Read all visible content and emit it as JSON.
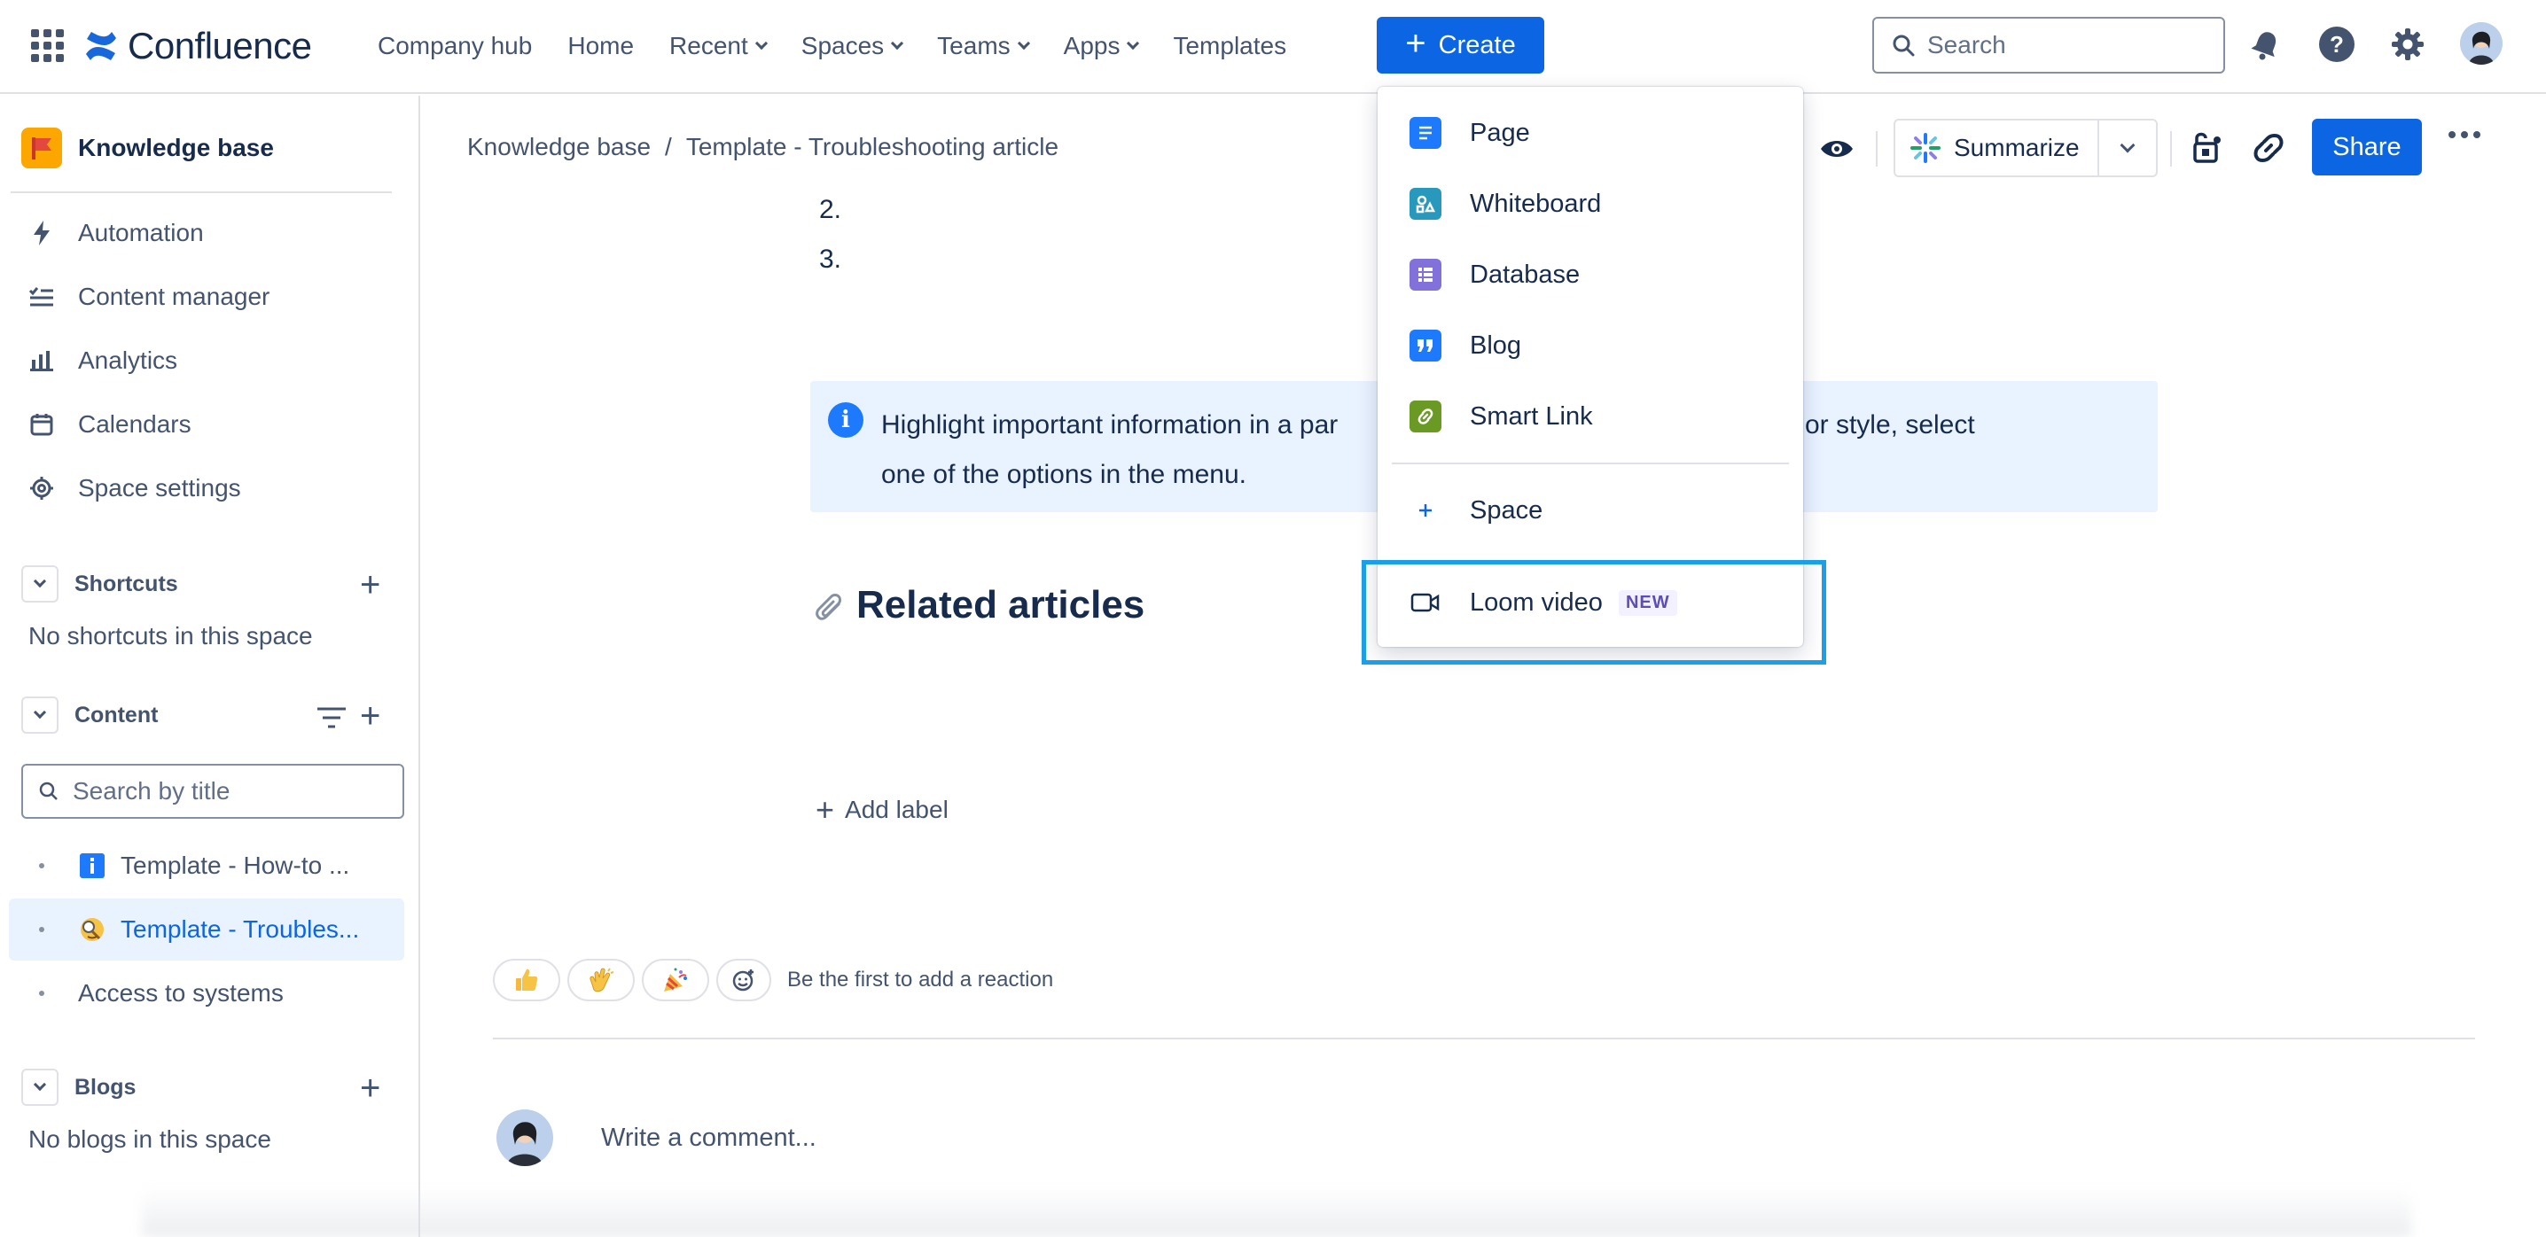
{
  "topnav": {
    "app_name": "Confluence",
    "items": [
      {
        "label": "Company hub",
        "dropdown": false
      },
      {
        "label": "Home",
        "dropdown": false
      },
      {
        "label": "Recent",
        "dropdown": true
      },
      {
        "label": "Spaces",
        "dropdown": true
      },
      {
        "label": "Teams",
        "dropdown": true
      },
      {
        "label": "Apps",
        "dropdown": true
      },
      {
        "label": "Templates",
        "dropdown": false
      }
    ],
    "create_label": "Create",
    "search_placeholder": "Search"
  },
  "sidebar": {
    "space_name": "Knowledge base",
    "items": [
      {
        "label": "Automation",
        "icon": "lightning-icon"
      },
      {
        "label": "Content manager",
        "icon": "content-manager-icon"
      },
      {
        "label": "Analytics",
        "icon": "analytics-icon"
      },
      {
        "label": "Calendars",
        "icon": "calendar-icon"
      },
      {
        "label": "Space settings",
        "icon": "gear-icon"
      }
    ],
    "shortcuts": {
      "title": "Shortcuts",
      "empty": "No shortcuts in this space"
    },
    "content": {
      "title": "Content",
      "search_placeholder": "Search by title",
      "tree": [
        {
          "label": "Template - How-to ...",
          "icon": "info-page-icon",
          "selected": false
        },
        {
          "label": "Template - Troubles...",
          "icon": "magnifier-emoji-icon",
          "selected": true
        },
        {
          "label": "Access to systems",
          "icon": "",
          "selected": false
        }
      ]
    },
    "blogs": {
      "title": "Blogs",
      "empty": "No blogs in this space"
    }
  },
  "main": {
    "breadcrumb": {
      "parent": "Knowledge base",
      "separator": "/",
      "current": "Template - Troubleshooting article"
    },
    "list_numbers": [
      "2.",
      "3."
    ],
    "info_panel": {
      "line1_left": "Highlight important information in a par",
      "line1_right": "s color or style, select",
      "line2": "one of the options in the menu."
    },
    "related_heading": "Related articles",
    "add_label": "Add label",
    "reactions": {
      "prompt": "Be the first to add a reaction",
      "emojis": [
        "thumbs-up",
        "clapping-hands",
        "party-popper"
      ]
    },
    "comment_placeholder": "Write a comment..."
  },
  "toolbar": {
    "summarize_label": "Summarize",
    "share_label": "Share"
  },
  "create_menu": {
    "items": [
      {
        "label": "Page",
        "icon": "page-icon",
        "color": "#1d7afc"
      },
      {
        "label": "Whiteboard",
        "icon": "whiteboard-icon",
        "color": "#2898bd"
      },
      {
        "label": "Database",
        "icon": "database-icon",
        "color": "#8270db"
      },
      {
        "label": "Blog",
        "icon": "blog-quote-icon",
        "color": "#1d7afc"
      },
      {
        "label": "Smart Link",
        "icon": "smart-link-icon",
        "color": "#6a9a23"
      },
      {
        "label": "Space",
        "icon": "plus-icon",
        "color": "#0c66e4"
      },
      {
        "label": "Loom video",
        "icon": "video-camera-icon",
        "badge": "NEW"
      }
    ]
  },
  "colors": {
    "brand": "#0c66e4",
    "highlight": "#1b9fe8",
    "info_bg": "#e9f2ff"
  }
}
